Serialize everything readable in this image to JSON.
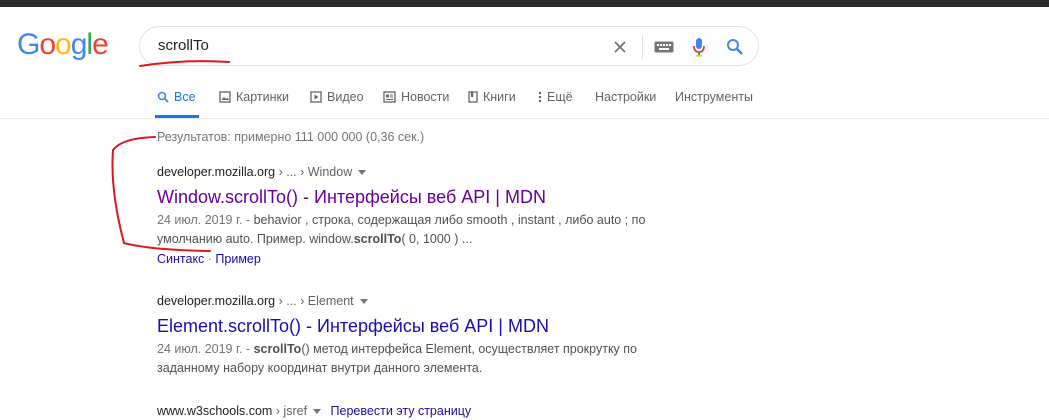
{
  "logo": {
    "letters": [
      "G",
      "o",
      "o",
      "g",
      "l",
      "e"
    ],
    "colors": [
      "#4285f4",
      "#ea4335",
      "#fbbc05",
      "#4285f4",
      "#34a853",
      "#ea4335"
    ]
  },
  "search": {
    "query": "scrollTo",
    "icons": [
      "clear-icon",
      "keyboard-icon",
      "mic-icon",
      "search-icon"
    ]
  },
  "tabs": [
    {
      "label": "Все",
      "icon": "search-icon",
      "active": true
    },
    {
      "label": "Картинки",
      "icon": "image-icon"
    },
    {
      "label": "Видео",
      "icon": "video-icon"
    },
    {
      "label": "Новости",
      "icon": "news-icon"
    },
    {
      "label": "Книги",
      "icon": "book-icon"
    },
    {
      "label": "Ещё",
      "icon": "more-vert-icon"
    },
    {
      "label": "Настройки"
    },
    {
      "label": "Инструменты"
    }
  ],
  "stats": "Результатов: примерно 111 000 000 (0,36 сек.)",
  "results": [
    {
      "site": "developer.mozilla.org",
      "path": " › ... › Window",
      "title": "Window.scrollTo() - Интерфейсы веб API | MDN",
      "date": "24 июл. 2019 г. - ",
      "snippet_a": "behavior , строка, содержащая либо smooth , instant , либо auto ; по умолчанию auto. Пример. window.",
      "snippet_bold": "scrollTo",
      "snippet_b": "( 0, 1000 ) ...",
      "sitelink_1": "Синтакс",
      "sitelink_sep": " · ",
      "sitelink_2": "Пример"
    },
    {
      "site": "developer.mozilla.org",
      "path": " › ... › Element",
      "title": "Element.scrollTo() - Интерфейсы веб API | MDN",
      "date": "24 июл. 2019 г. - ",
      "snippet_bold": "scrollTo",
      "snippet_b": "() метод интерфейса Element, осуществляет прокрутку по заданному набору координат внутри данного элемента."
    },
    {
      "site": "www.w3schools.com",
      "path": " › jsref",
      "translate": "Перевести эту страницу"
    }
  ],
  "colors": {
    "link": "#1a0dab",
    "visited": "#660099",
    "accent": "#1a73e8",
    "annotation": "#e0141e"
  }
}
